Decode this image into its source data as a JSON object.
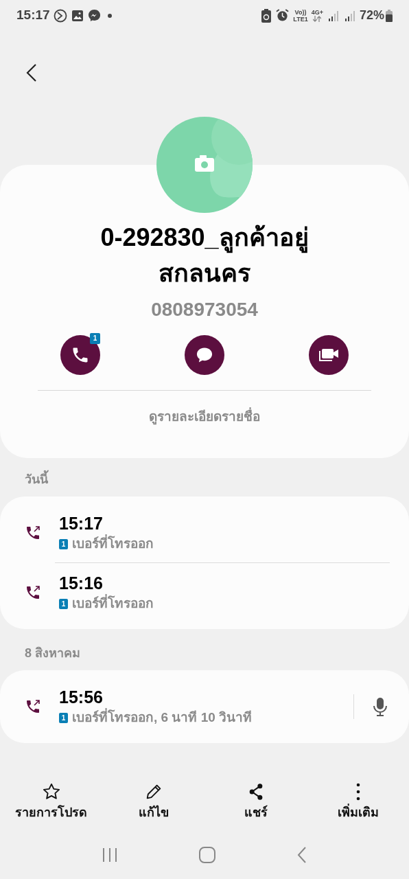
{
  "status_bar": {
    "time": "15:17",
    "volte": "Vo))",
    "lte": "LTE1",
    "network": "4G+",
    "battery": "72%"
  },
  "contact": {
    "name_lines": [
      "0-292830_ลูกค้าอยู่",
      "สกลนคร"
    ],
    "phone": "0808973054",
    "actions": [
      {
        "kind": "call",
        "badge": "1"
      },
      {
        "kind": "message"
      },
      {
        "kind": "video"
      }
    ],
    "details_link": "ดูรายละเอียดรายชื่อ"
  },
  "call_groups": [
    {
      "date": "วันนี้",
      "calls": [
        {
          "kind": "outgoing",
          "time": "15:17",
          "sim": "1",
          "detail": "เบอร์ที่โทรออก",
          "recording": false
        },
        {
          "kind": "outgoing",
          "time": "15:16",
          "sim": "1",
          "detail": "เบอร์ที่โทรออก",
          "recording": false
        }
      ]
    },
    {
      "date": "8 สิงหาคม",
      "calls": [
        {
          "kind": "outgoing",
          "time": "15:56",
          "sim": "1",
          "detail": "เบอร์ที่โทรออก, 6 นาที 10 วินาที",
          "recording": true
        }
      ]
    }
  ],
  "bottom_bar": [
    {
      "kind": "favorite",
      "label": "รายการโปรด"
    },
    {
      "kind": "edit",
      "label": "แก้ไข"
    },
    {
      "kind": "share",
      "label": "แชร์"
    },
    {
      "kind": "more",
      "label": "เพิ่มเติม"
    }
  ]
}
